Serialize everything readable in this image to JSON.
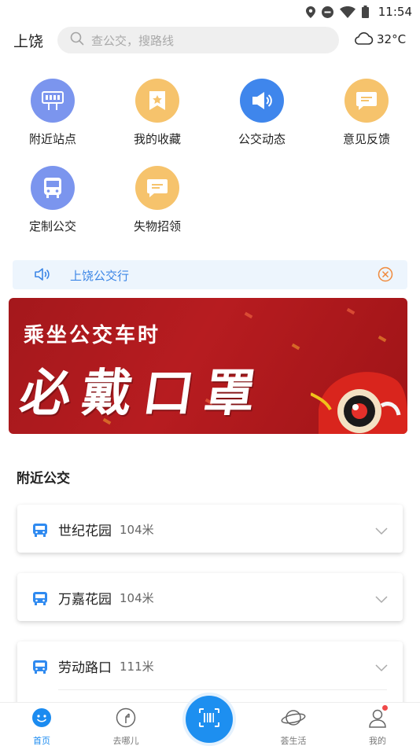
{
  "status_bar": {
    "time": "11:54",
    "icons": [
      "location-icon",
      "do-not-disturb-icon",
      "wifi-icon",
      "battery-icon"
    ]
  },
  "header": {
    "city": "上饶",
    "search_placeholder": "查公交，搜路线",
    "temperature": "32°C",
    "weather_icon": "cloud-icon"
  },
  "shortcuts": [
    {
      "label": "附近站点",
      "icon": "bus-stop-icon",
      "color": "#7b95ee"
    },
    {
      "label": "我的收藏",
      "icon": "bookmark-star-icon",
      "color": "#f6c36c"
    },
    {
      "label": "公交动态",
      "icon": "megaphone-icon",
      "color": "#3f86ec"
    },
    {
      "label": "意见反馈",
      "icon": "feedback-icon",
      "color": "#f6c36c"
    },
    {
      "label": "定制公交",
      "icon": "bus-icon",
      "color": "#7b95ee"
    },
    {
      "label": "失物招领",
      "icon": "message-icon",
      "color": "#f6c36c"
    }
  ],
  "notice": {
    "text": "上饶公交行"
  },
  "banner": {
    "line1": "乘坐公交车时",
    "line2": "必戴口罩"
  },
  "nearby": {
    "title": "附近公交",
    "stops": [
      {
        "name": "世纪花园",
        "distance": "104米"
      },
      {
        "name": "万嘉花园",
        "distance": "104米"
      },
      {
        "name": "劳动路口",
        "distance": "111米"
      }
    ]
  },
  "bottom_nav": {
    "items": [
      {
        "label": "首页",
        "icon": "home-face-icon",
        "active": true
      },
      {
        "label": "去哪儿",
        "icon": "compass-arrow-icon",
        "active": false
      },
      {
        "label": "",
        "icon": "scan-icon",
        "active": false
      },
      {
        "label": "荟生活",
        "icon": "planet-icon",
        "active": false
      },
      {
        "label": "我的",
        "icon": "user-icon",
        "active": false
      }
    ]
  },
  "colors": {
    "accent": "#1d8ff0",
    "notice_text": "#3c86e6",
    "banner_red": "#b71c20"
  }
}
